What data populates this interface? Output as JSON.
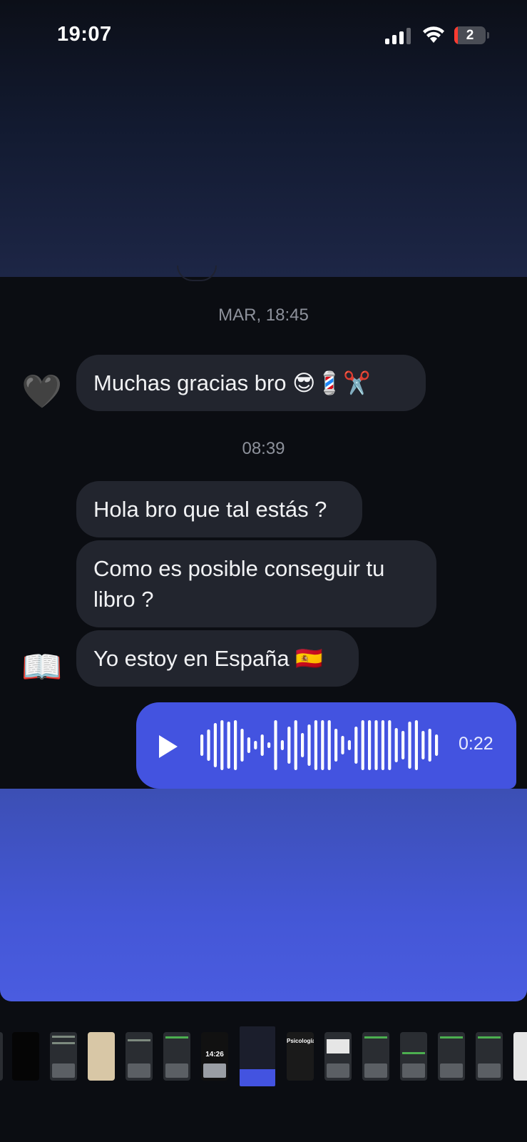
{
  "status_bar": {
    "time": "19:07",
    "battery_level": "2"
  },
  "conversation": {
    "separator_1": "MAR, 18:45",
    "separator_2": "08:39",
    "messages": [
      {
        "text": "Muchas gracias bro 😎💈✂️",
        "avatar": "🖤"
      },
      {
        "text": "Hola bro que tal estás ?"
      },
      {
        "text": "Como es posible conseguir tu libro ?"
      },
      {
        "text": "Yo estoy en España 🇪🇸",
        "avatar": "📖"
      }
    ],
    "voice_message": {
      "duration": "0:22"
    }
  },
  "thumbnail_7_time": "14:26",
  "thumbnail_9_title": "Psicología",
  "colors": {
    "background": "#0b0d12",
    "incoming_bubble": "#22252e",
    "outgoing_bubble": "#4353e0",
    "timestamp": "#8d919b"
  }
}
